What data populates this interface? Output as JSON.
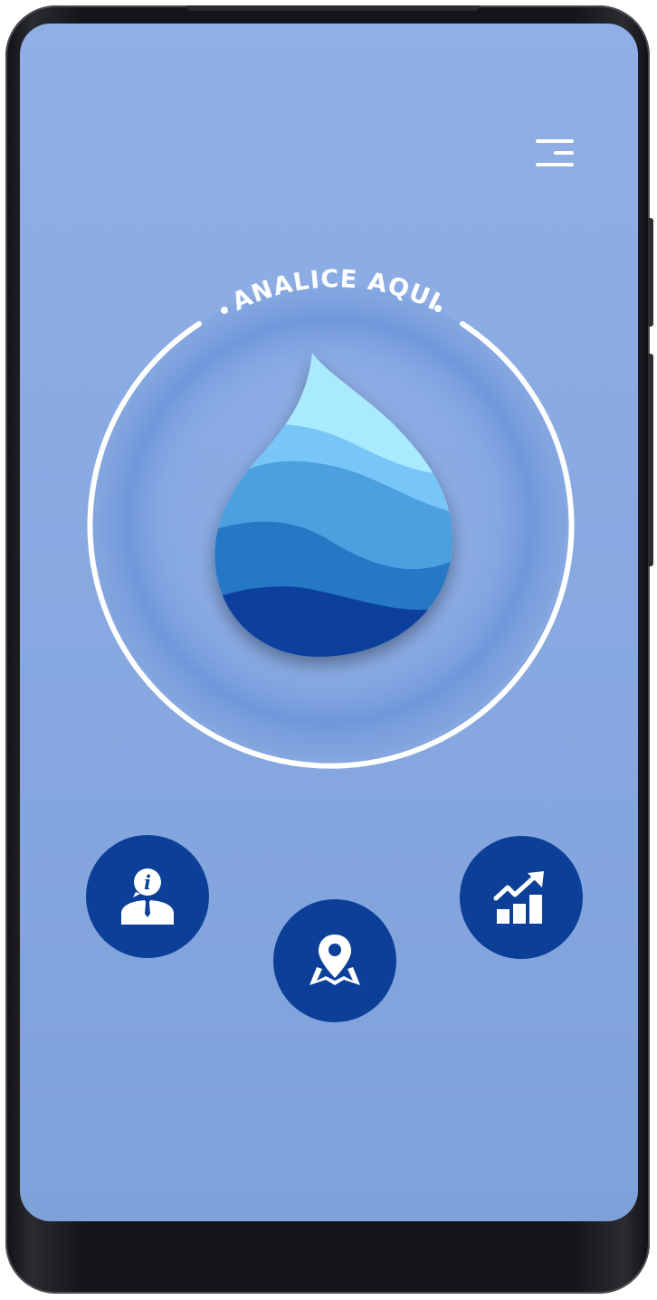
{
  "screen": {
    "ring_label": "ANALICE AQUI",
    "icons": {
      "menu": "menu-icon",
      "drop": "water-drop-icon",
      "info": "info-person-icon",
      "map": "map-pin-icon",
      "chart": "growth-chart-icon"
    }
  },
  "colors": {
    "background": "#8aaae2",
    "button": "#0b3f98",
    "ring": "#ffffff",
    "drop_layers": [
      "#a9eaff",
      "#77c6f7",
      "#4ea0e0",
      "#2677c4",
      "#0b409c"
    ]
  }
}
